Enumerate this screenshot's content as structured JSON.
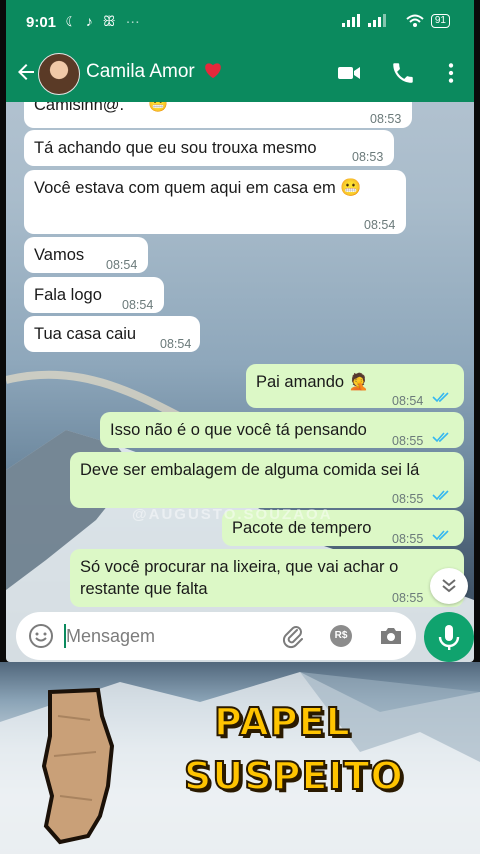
{
  "status_bar": {
    "time": "9:01",
    "battery": "91"
  },
  "header": {
    "contact_name": "Camila Amor"
  },
  "messages": [
    {
      "dir": "in",
      "text": "Camisinh@.",
      "time": "08:53"
    },
    {
      "dir": "in",
      "text": "Tá achando que eu sou trouxa mesmo",
      "time": "08:53"
    },
    {
      "dir": "in",
      "text": "Você estava com quem aqui em  casa em",
      "time": "08:54"
    },
    {
      "dir": "in",
      "text": "Vamos",
      "time": "08:54"
    },
    {
      "dir": "in",
      "text": "Fala logo",
      "time": "08:54"
    },
    {
      "dir": "in",
      "text": "Tua casa caiu",
      "time": "08:54"
    },
    {
      "dir": "out",
      "text": "Pai amando",
      "time": "08:54"
    },
    {
      "dir": "out",
      "text": "Isso não é o que você tá pensando",
      "time": "08:55"
    },
    {
      "dir": "out",
      "text": "Deve ser embalagem de alguma comida sei lá",
      "time": "08:55"
    },
    {
      "dir": "out",
      "text": "Pacote de tempero",
      "time": "08:55"
    },
    {
      "dir": "out",
      "text": "Só você procurar na lixeira, que vai achar o restante que falta",
      "time": "08:55"
    }
  ],
  "watermark": "@AUGUSTO.SOUZAOA",
  "input": {
    "placeholder": "Mensagem"
  },
  "overlay": {
    "line1": "PAPEL",
    "line2": "SUSPEITO"
  },
  "colors": {
    "header": "#0b8a5e",
    "incoming": "#ffffff",
    "outgoing": "#dcf8c6",
    "ticks": "#34b7f1",
    "overlay_text": "#ffc400"
  },
  "icons": [
    "back-arrow-icon",
    "video-call-icon",
    "phone-icon",
    "more-vert-icon",
    "emoji-icon",
    "attach-icon",
    "currency-icon",
    "camera-icon",
    "mic-icon",
    "chevron-down-icon",
    "double-check-icon"
  ]
}
